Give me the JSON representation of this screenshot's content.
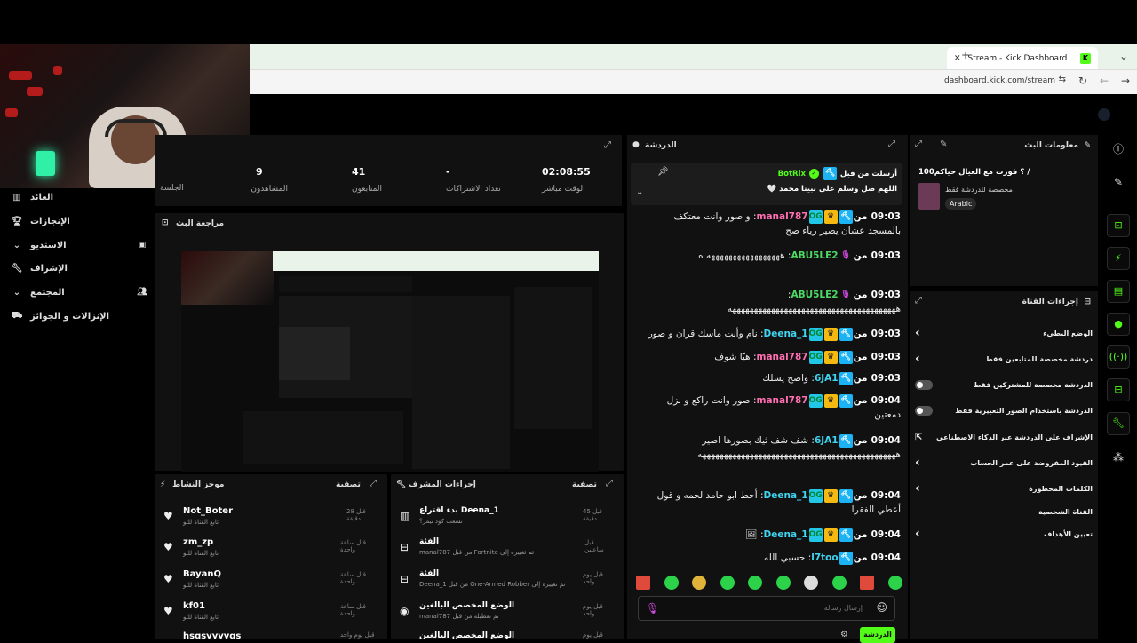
{
  "browser": {
    "tab_title": "Stream - Kick Dashboard",
    "url": "dashboard.kick.com/stream",
    "new_tab": "+",
    "close_tab": "✕",
    "menu": "⌄"
  },
  "nav": {
    "items": [
      {
        "label": "العائد",
        "icon": "chart-icon"
      },
      {
        "label": "الإنجازات",
        "icon": "trophy-icon"
      },
      {
        "label": "الاستديو",
        "icon": "studio-icon",
        "chevron": true
      },
      {
        "label": "الإشراف",
        "icon": "wrench-icon"
      },
      {
        "label": "المجتمع",
        "icon": "community-icon",
        "chevron": true
      },
      {
        "label": "الإنزالات و الجوائز",
        "icon": "drops-icon"
      }
    ]
  },
  "stats": {
    "session": {
      "value": "",
      "label": "الجلسة"
    },
    "viewers": {
      "value": "9",
      "label": "المشاهدون"
    },
    "followers": {
      "value": "41",
      "label": "المتابعون"
    },
    "subs": {
      "value": "-",
      "label": "تعداد الاشتراكات"
    },
    "uptime": {
      "value": "02:08:55",
      "label": "الوقت مباشر"
    }
  },
  "preview": {
    "title": "مراجعة البث"
  },
  "activity": {
    "title": "موجز النشاط",
    "filter": "تصفية",
    "items": [
      {
        "name": "Not_Boter",
        "sub": "تابع القناة للتو",
        "time": "قبل 28 دقيقة"
      },
      {
        "name": "zm_zp",
        "sub": "تابع القناة للتو",
        "time": "قبل ساعة واحدة"
      },
      {
        "name": "BayanQ",
        "sub": "تابع القناة للتو",
        "time": "قبل ساعة واحدة"
      },
      {
        "name": "kf01",
        "sub": "تابع القناة للتو",
        "time": "قبل ساعة واحدة"
      },
      {
        "name": "hsgsyyyygs",
        "sub": "",
        "time": "قبل يوم واحد"
      }
    ]
  },
  "mod_actions": {
    "title": "إجراءات المشرف",
    "filter": "تصفية",
    "items": [
      {
        "title": "بدء اقتراع Deena_1",
        "sub": "تشعب كود تيمز؟",
        "time": "قبل 45 دقيقة"
      },
      {
        "title": "الفئة",
        "sub": "manal787 من قبل Fortnite تم تغييره إلى",
        "time": "قبل ساعتين"
      },
      {
        "title": "الفئة",
        "sub": "Deena_1 من قبل One-Armed Robber تم تغييره إلى",
        "time": "قبل يوم واحد"
      },
      {
        "title": "الوضع المخصص البالغين",
        "sub": "manal787 تم تعطيله من قبل",
        "time": "قبل يوم واحد"
      },
      {
        "title": "الوضع المخصص البالغين",
        "sub": "",
        "time": "قبل يوم واحد"
      }
    ]
  },
  "chat": {
    "title": "الدردشة",
    "pinned_user": "BotRix",
    "pinned_by": "أرسلت من قبل",
    "pinned_text": "اللهم صل وسلم على نبينا محمد 🤍",
    "input_placeholder": "إرسال رسالة",
    "send_label": "الدردشة",
    "messages": [
      {
        "time": "09:03",
        "prefix": "من",
        "user": "manal787",
        "color": "#ff6fb1",
        "badges": [
          "mod",
          "crown",
          "og"
        ],
        "text": "و صور وانت معتكف بالمسجد عشان يصير رياء صح"
      },
      {
        "time": "09:03",
        "prefix": "من",
        "user": "ABU5LE2",
        "color": "#4cd964",
        "badges": [
          "mic"
        ],
        "text": "هههههههههههههههههه ه"
      },
      {
        "time": "09:03",
        "prefix": "من",
        "user": "ABU5LE2",
        "color": "#4cd964",
        "badges": [
          "mic"
        ],
        "text": "هههههههههههههههههههههههههههههههههههههههه"
      },
      {
        "time": "09:03",
        "prefix": "من",
        "user": "Deena_1",
        "color": "#3fd4f0",
        "badges": [
          "mod",
          "crown",
          "og"
        ],
        "text": "نام وأنت ماسك قران و صور"
      },
      {
        "time": "09:03",
        "prefix": "من",
        "user": "manal787",
        "color": "#ff6fb1",
        "badges": [
          "mod",
          "crown",
          "og"
        ],
        "text": "هيّا شوف"
      },
      {
        "time": "09:03",
        "prefix": "من",
        "user": "6JA1",
        "color": "#3fd4f0",
        "badges": [
          "mod"
        ],
        "text": "واضح يسلك"
      },
      {
        "time": "09:04",
        "prefix": "من",
        "user": "manal787",
        "color": "#ff6fb1",
        "badges": [
          "mod",
          "crown",
          "og"
        ],
        "text": "صور وانت راكع و نزل دمعتين"
      },
      {
        "time": "09:04",
        "prefix": "من",
        "user": "6JA1",
        "color": "#3fd4f0",
        "badges": [
          "mod"
        ],
        "text": "شف شف ثيك بصورها اصير ههههههههههههههههههههههههههههههههههههههههههههههه"
      },
      {
        "time": "09:04",
        "prefix": "من",
        "user": "Deena_1",
        "color": "#3fd4f0",
        "badges": [
          "mod",
          "crown",
          "og"
        ],
        "text": "أحط ابو حامد لحمه و قول أعطي الفقرا"
      },
      {
        "time": "09:04",
        "prefix": "من",
        "user": "Deena_1",
        "color": "#3fd4f0",
        "badges": [
          "mod",
          "crown",
          "og"
        ],
        "text": "🖼"
      },
      {
        "time": "09:04",
        "prefix": "من",
        "user": "l7too",
        "color": "#3fd4f0",
        "badges": [
          "mod"
        ],
        "text": "حسبي الله"
      }
    ]
  },
  "stream_info": {
    "title": "معلومات البث",
    "stream_title": "100؟ فورت مع العيال حياكم /",
    "category_note": "مخصصة للدردشة فقط",
    "language": "Arabic"
  },
  "channel_actions": {
    "title": "إجراءات القناة",
    "rows": [
      {
        "label": "الوضع البطيء",
        "control": "chevron"
      },
      {
        "label": "دردشة مخصصة للمتابعين فقط",
        "control": "chevron"
      },
      {
        "label": "الدردشة مخصصة للمشتركين فقط",
        "control": "toggle"
      },
      {
        "label": "الدردشة باستخدام الصور التعبيرية فقط",
        "control": "toggle"
      },
      {
        "label": "الإشراف على الدردشة عبر الذكاء الاصطناعي",
        "control": "external"
      },
      {
        "label": "القيود المفروضة على عمر الحساب",
        "control": "chevron"
      },
      {
        "label": "الكلمات المحظورة",
        "control": "chevron"
      },
      {
        "label": "القناة الشخصية",
        "control": "none"
      },
      {
        "label": "تعيين الأهداف",
        "control": "chevron"
      }
    ]
  },
  "colors": {
    "accent": "#53fc18",
    "panel": "#111111",
    "background": "#000000"
  }
}
